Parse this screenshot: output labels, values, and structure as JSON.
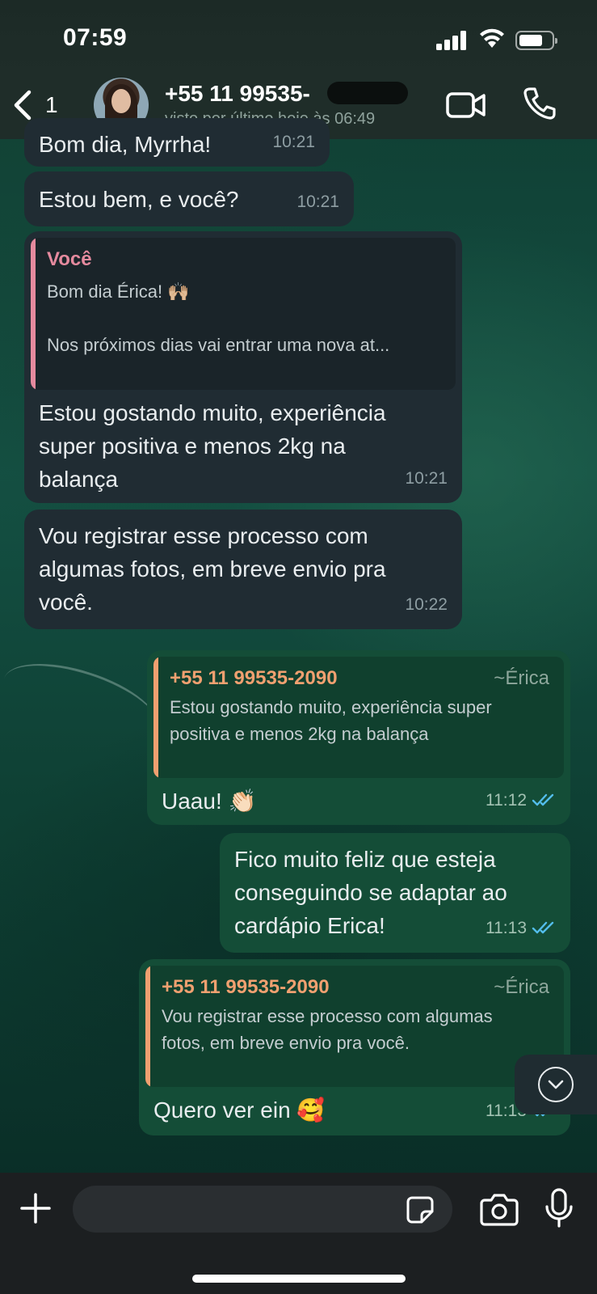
{
  "status_bar": {
    "time": "07:59"
  },
  "header": {
    "back_count": "1",
    "contact_name": "+55 11 99535-",
    "last_seen": "visto por último hoje às 06:49"
  },
  "messages": [
    {
      "dir": "in",
      "text": "Bom dia, Myrrha!",
      "time": "10:21"
    },
    {
      "dir": "in",
      "text": "Estou bem, e você?",
      "time": "10:21"
    },
    {
      "dir": "in",
      "quote": {
        "author": "Você",
        "line1": "Bom dia Érica!",
        "line1_emoji": "🙌🏼",
        "line2": "Nos próximos dias vai entrar uma nova at..."
      },
      "lines": [
        "Estou gostando muito, experiência",
        "super positiva e menos 2kg na",
        "balança"
      ],
      "time": "10:21"
    },
    {
      "dir": "in",
      "lines": [
        "Vou registrar esse processo com",
        "algumas fotos, em breve envio pra",
        "você."
      ],
      "time": "10:22"
    },
    {
      "dir": "out",
      "quote": {
        "author": "+55 11 99535-2090",
        "tag": "~Érica",
        "line1": "Estou gostando muito, experiência super",
        "line2": "positiva e menos 2kg na balança"
      },
      "text": "Uaau! 👏🏻",
      "time": "11:12"
    },
    {
      "dir": "out",
      "lines": [
        "Fico muito feliz que esteja",
        "conseguindo se adaptar ao",
        "cardápio Erica!"
      ],
      "time": "11:13"
    },
    {
      "dir": "out",
      "quote": {
        "author": "+55 11 99535-2090",
        "tag": "~Érica",
        "line1": "Vou registrar esse processo com algumas",
        "line2": "fotos, em breve envio pra você."
      },
      "text": "Quero ver ein 🥰",
      "time": "11:13"
    }
  ],
  "colors": {
    "incoming_bubble": "#202c33",
    "outgoing_bubble": "#144d37",
    "quote_pink": "#e58a9e",
    "quote_orange": "#f0a070",
    "read_ticks": "#53bdeb"
  },
  "icons": [
    "chevron-left-icon",
    "video-camera-icon",
    "phone-icon",
    "chevron-down-icon",
    "plus-icon",
    "sticker-icon",
    "camera-icon",
    "microphone-icon"
  ],
  "input": {
    "placeholder": ""
  }
}
